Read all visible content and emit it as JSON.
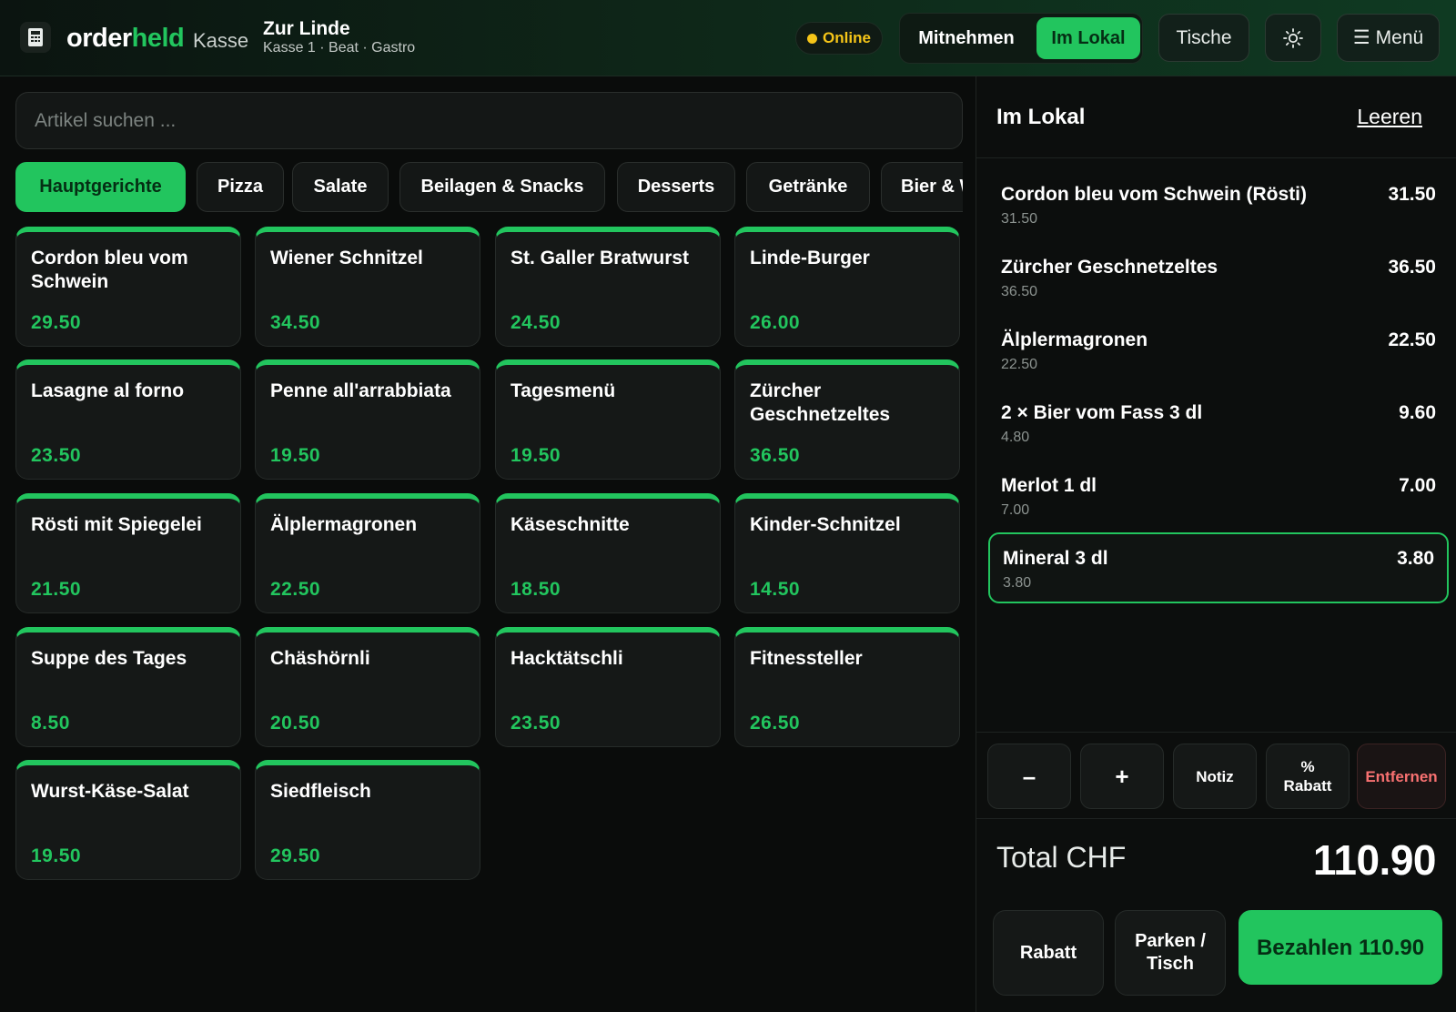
{
  "header": {
    "brand_part1": "order",
    "brand_part2": "held",
    "brand_sub": "Kasse",
    "venue_name": "Zur Linde",
    "venue_sub": "Kasse 1 · Beat · Gastro",
    "status": "Online",
    "mode_takeaway": "Mitnehmen",
    "mode_local": "Im Lokal",
    "tables_label": "Tische",
    "menu_label": "Menü",
    "menu_icon": "☰"
  },
  "search": {
    "placeholder": "Artikel suchen ..."
  },
  "categories": [
    "Hauptgerichte",
    "Pizza",
    "Salate",
    "Beilagen & Snacks",
    "Desserts",
    "Getränke",
    "Bier & Wein"
  ],
  "active_category": "Hauptgerichte",
  "products": [
    {
      "name": "Cordon bleu vom Schwein",
      "price": "29.50"
    },
    {
      "name": "Wiener Schnitzel",
      "price": "34.50"
    },
    {
      "name": "St. Galler Bratwurst",
      "price": "24.50"
    },
    {
      "name": "Linde-Burger",
      "price": "26.00"
    },
    {
      "name": "Lasagne al forno",
      "price": "23.50"
    },
    {
      "name": "Penne all'arrabbiata",
      "price": "19.50"
    },
    {
      "name": "Tagesmenü",
      "price": "19.50"
    },
    {
      "name": "Zürcher Geschnetzeltes",
      "price": "36.50"
    },
    {
      "name": "Rösti mit Spiegelei",
      "price": "21.50"
    },
    {
      "name": "Älplermagronen",
      "price": "22.50"
    },
    {
      "name": "Käseschnitte",
      "price": "18.50"
    },
    {
      "name": "Kinder-Schnitzel",
      "price": "14.50"
    },
    {
      "name": "Suppe des Tages",
      "price": "8.50"
    },
    {
      "name": "Chäshörnli",
      "price": "20.50"
    },
    {
      "name": "Hacktätschli",
      "price": "23.50"
    },
    {
      "name": "Fitnessteller",
      "price": "26.50"
    },
    {
      "name": "Wurst-Käse-Salat",
      "price": "19.50"
    },
    {
      "name": "Siedfleisch",
      "price": "29.50"
    }
  ],
  "cart": {
    "title": "Im Lokal",
    "clear_label": "Leeren",
    "lines": [
      {
        "name": "Cordon bleu vom Schwein (Rösti)",
        "unit": "31.50",
        "total": "31.50",
        "selected": false
      },
      {
        "name": "Zürcher Geschnetzeltes",
        "unit": "36.50",
        "total": "36.50",
        "selected": false
      },
      {
        "name": "Älplermagronen",
        "unit": "22.50",
        "total": "22.50",
        "selected": false
      },
      {
        "name": "2 × Bier vom Fass 3 dl",
        "unit": "4.80",
        "total": "9.60",
        "selected": false
      },
      {
        "name": "Merlot 1 dl",
        "unit": "7.00",
        "total": "7.00",
        "selected": false
      },
      {
        "name": "Mineral 3 dl",
        "unit": "3.80",
        "total": "3.80",
        "selected": true
      }
    ],
    "actions": {
      "minus": "–",
      "plus": "+",
      "note": "Notiz",
      "discount_symbol": "%",
      "discount": "Rabatt",
      "remove": "Entfernen"
    },
    "total_label": "Total CHF",
    "total_value": "110.90",
    "footer": {
      "discount": "Rabatt",
      "park_line1": "Parken /",
      "park_line2": "Tisch",
      "pay": "Bezahlen 110.90"
    }
  },
  "colors": {
    "accent": "#22c55e",
    "status": "#f5c518",
    "danger": "#f87171",
    "background": "#0a0c0b"
  }
}
